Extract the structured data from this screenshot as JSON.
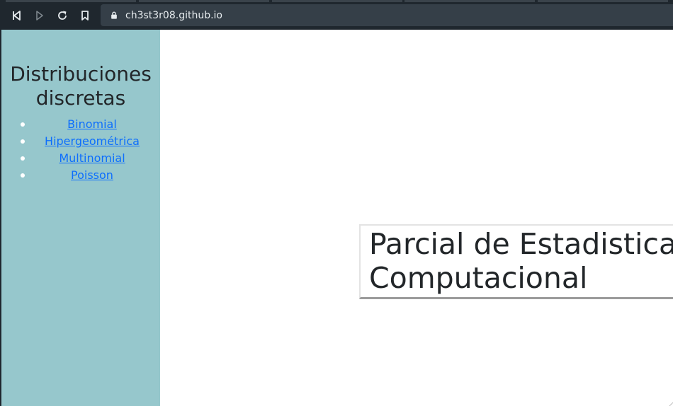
{
  "browser": {
    "url": "ch3st3r08.github.io",
    "icons": [
      "back-icon",
      "forward-icon",
      "reload-icon",
      "bookmark-icon",
      "lock-icon"
    ]
  },
  "sidebar": {
    "title_line1": "Distribuciones",
    "title_line2": "discretas",
    "items": [
      {
        "label": "Binomial"
      },
      {
        "label": "Hipergeométrica"
      },
      {
        "label": "Multinomial"
      },
      {
        "label": "Poisson"
      }
    ]
  },
  "main": {
    "title_line1": "Parcial de Estadistica",
    "title_line2": "Computacional"
  },
  "colors": {
    "chrome": "#1f272e",
    "urlbar": "#353f48",
    "sidebar": "#96c7cc",
    "link": "#0d6efd",
    "text": "#222629"
  }
}
